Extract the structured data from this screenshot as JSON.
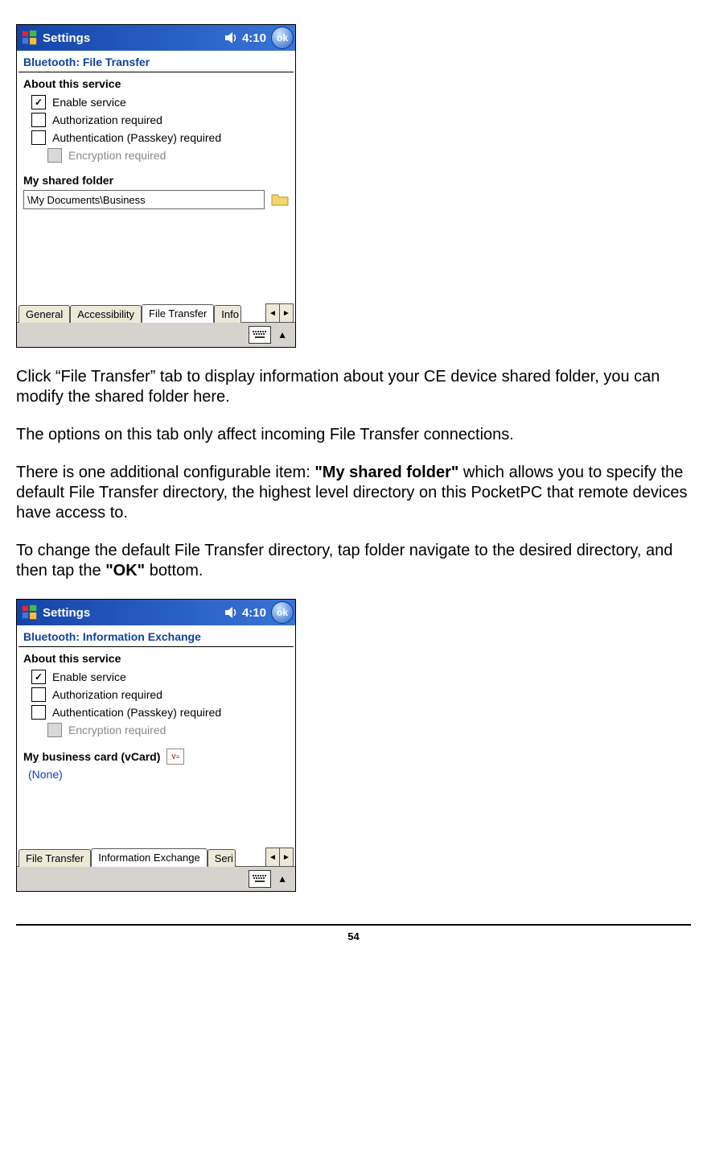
{
  "page_number": "54",
  "screenshot1": {
    "title": "Settings",
    "time": "4:10",
    "ok": "ok",
    "header": "Bluetooth: File Transfer",
    "section1": "About this service",
    "opts": {
      "enable": "Enable service",
      "auth_req": "Authorization required",
      "authn_req": "Authentication (Passkey) required",
      "enc_req": "Encryption required"
    },
    "section2": "My shared folder",
    "path": "\\My Documents\\Business",
    "tabs": {
      "general": "General",
      "accessibility": "Accessibility",
      "file_transfer": "File Transfer",
      "info": "Info"
    }
  },
  "doc": {
    "p1": "Click “File Transfer” tab to display information about your CE device shared folder, you can modify the shared folder here.",
    "p2": "The options on this tab only affect incoming File Transfer connections.",
    "p3a": "There is one additional configurable item: ",
    "p3b": "\"My shared folder\"",
    "p3c": " which allows you to specify the default File Transfer directory, the highest level directory on this PocketPC that remote devices have access to.",
    "p4a": "To change the default File Transfer directory, tap folder navigate to the desired directory, and then tap the ",
    "p4b": "\"OK\"",
    "p4c": " bottom."
  },
  "screenshot2": {
    "title": "Settings",
    "time": "4:10",
    "ok": "ok",
    "header": "Bluetooth: Information Exchange",
    "section1": "About this service",
    "opts": {
      "enable": "Enable service",
      "auth_req": "Authorization required",
      "authn_req": "Authentication (Passkey) required",
      "enc_req": "Encryption required"
    },
    "section2": "My business card (vCard)",
    "vcard_icon_text": "V≡",
    "none": "(None)",
    "tabs": {
      "file_transfer": "File Transfer",
      "info_exchange": "Information Exchange",
      "seri": "Seri"
    }
  }
}
